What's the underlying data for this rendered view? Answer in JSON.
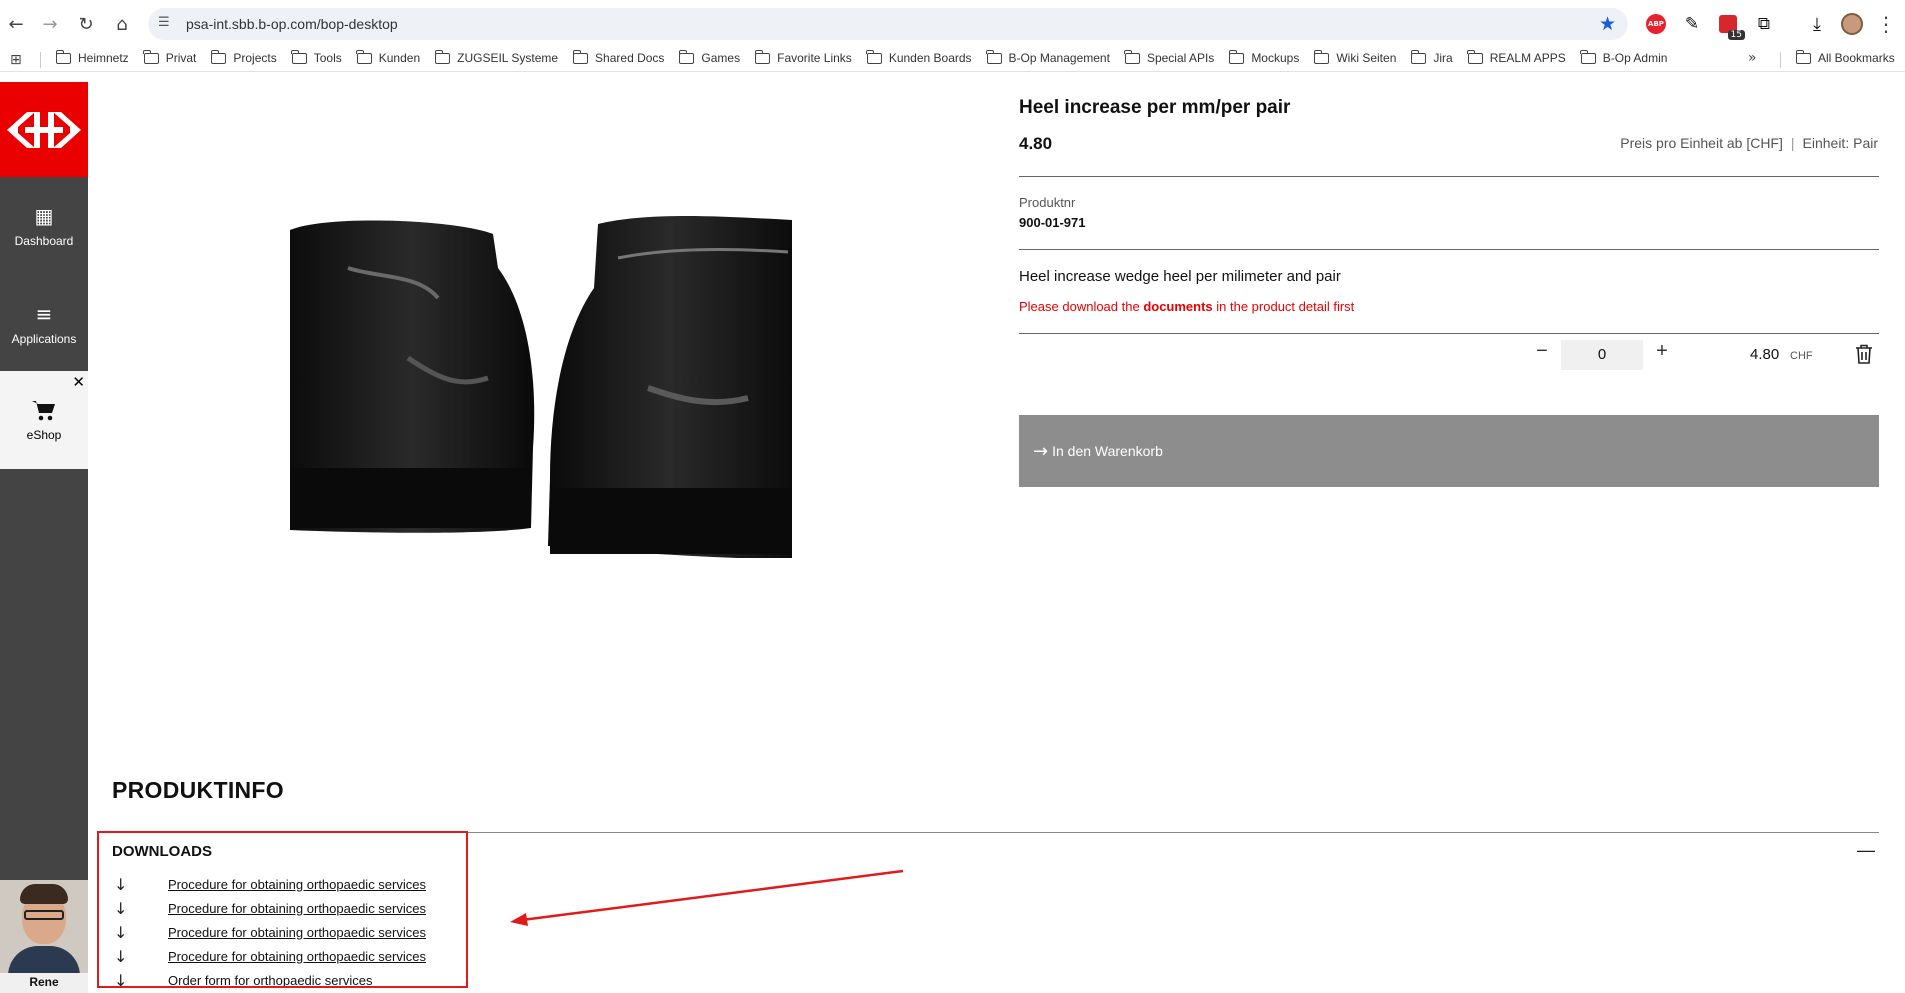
{
  "browser": {
    "url": "psa-int.sbb.b-op.com/bop-desktop",
    "abp_label": "ABP",
    "calendar_badge": "15",
    "bookmarks": [
      "Heimnetz",
      "Privat",
      "Projects",
      "Tools",
      "Kunden",
      "ZUGSEIL Systeme",
      "Shared Docs",
      "Games",
      "Favorite Links",
      "Kunden Boards",
      "B-Op Management",
      "Special APIs",
      "Mockups",
      "Wiki Seiten",
      "Jira",
      "REALM APPS",
      "B-Op Admin"
    ],
    "more_bookmarks": "»",
    "all_bookmarks": "All Bookmarks",
    "icons": [
      "back-icon",
      "forward-icon",
      "reload-icon",
      "home-icon",
      "site-settings-icon",
      "star-icon",
      "extensions-icon",
      "download-icon"
    ]
  },
  "sidebar": {
    "items": [
      {
        "label": "Dashboard",
        "icon": "dashboard-icon"
      },
      {
        "label": "Applications",
        "icon": "menu-icon"
      },
      {
        "label": "eShop",
        "icon": "cart-icon"
      }
    ],
    "user": {
      "name": "Rene"
    }
  },
  "product": {
    "title": "Heel increase per mm/per pair",
    "price": "4.80",
    "price_unit_label": "Preis pro Einheit ab [CHF]",
    "unit_label": "Einheit: Pair",
    "number_label": "Produktnr",
    "number": "900-01-971",
    "description": "Heel increase wedge heel per milimeter and pair",
    "warning_pre": "Please download the ",
    "warning_bold": "documents",
    "warning_post": " in the product detail first",
    "quantity": "0",
    "line_total": "4.80",
    "currency": "CHF",
    "add_to_cart": "In den Warenkorb"
  },
  "produktinfo": {
    "title": "PRODUKTINFO",
    "downloads_title": "DOWNLOADS",
    "collapse_symbol": "—",
    "downloads": [
      "Procedure for obtaining orthopaedic services",
      "Procedure for obtaining orthopaedic services",
      "Procedure for obtaining orthopaedic services",
      "Procedure for obtaining orthopaedic services",
      "Order form for orthopaedic services"
    ]
  },
  "annotation": {
    "color": "#e01b1b"
  },
  "colors": {
    "brand_red": "#eb0000",
    "sidebar_bg": "#444444",
    "button_gray": "#8d8d8d"
  }
}
